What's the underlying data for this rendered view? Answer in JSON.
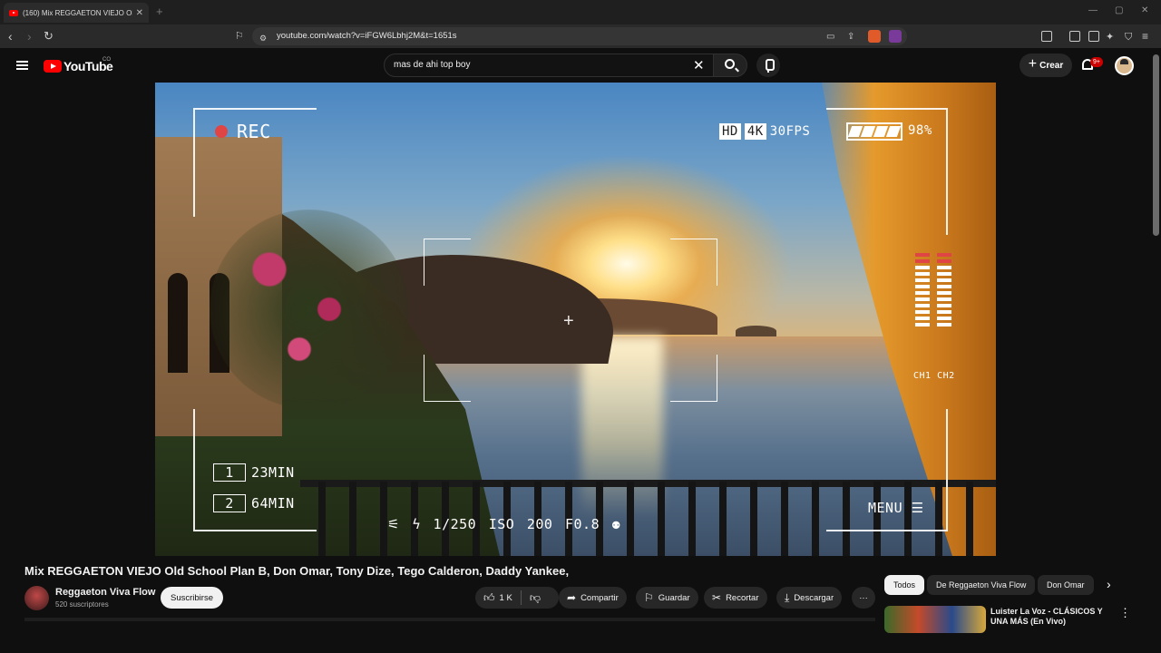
{
  "browser": {
    "tab_title": "(160) Mix REGGAETON VIEJO Ol",
    "new_tab": "+",
    "url": "youtube.com/watch?v=iFGW6Lbhj2M&t=1651s",
    "window_controls": [
      "—",
      "▢",
      "✕"
    ]
  },
  "youtube": {
    "logo_text": "YouTube",
    "logo_sup": "CO",
    "search_value": "mas de ahi top boy",
    "create_label": "Crear",
    "notif_badge": "9+"
  },
  "video_overlay": {
    "rec": "REC",
    "hd": "HD",
    "k4": "4K",
    "fps": "30FPS",
    "battery": "98%",
    "channels": "CH1 CH2",
    "min1_num": "1",
    "min1": "23MIN",
    "min2_num": "2",
    "min2": "64MIN",
    "bottom": "⚟  ϟ  1/250   ISO 200   F0.8  ⚉",
    "menu": "MENU ☰"
  },
  "video_info": {
    "title": "Mix REGGAETON VIEJO Old School Plan B, Don Omar, Tony Dize, Tego Calderon, Daddy Yankee,",
    "channel": "Reggaeton Viva Flow",
    "subscribers": "520 suscriptores",
    "subscribe": "Suscribirse",
    "likes": "1 K",
    "share": "Compartir",
    "save": "Guardar",
    "clip": "Recortar",
    "download": "Descargar"
  },
  "sidebar": {
    "chips": [
      "Todos",
      "De Reggaeton Viva Flow",
      "Don Omar"
    ],
    "rec_title": "Luister La Voz - CLÁSICOS Y UNA MÁS (En Vivo)"
  },
  "colors": {
    "accent": "#ff0000",
    "badge": "#cc0000",
    "bg": "#0f0f0f"
  }
}
